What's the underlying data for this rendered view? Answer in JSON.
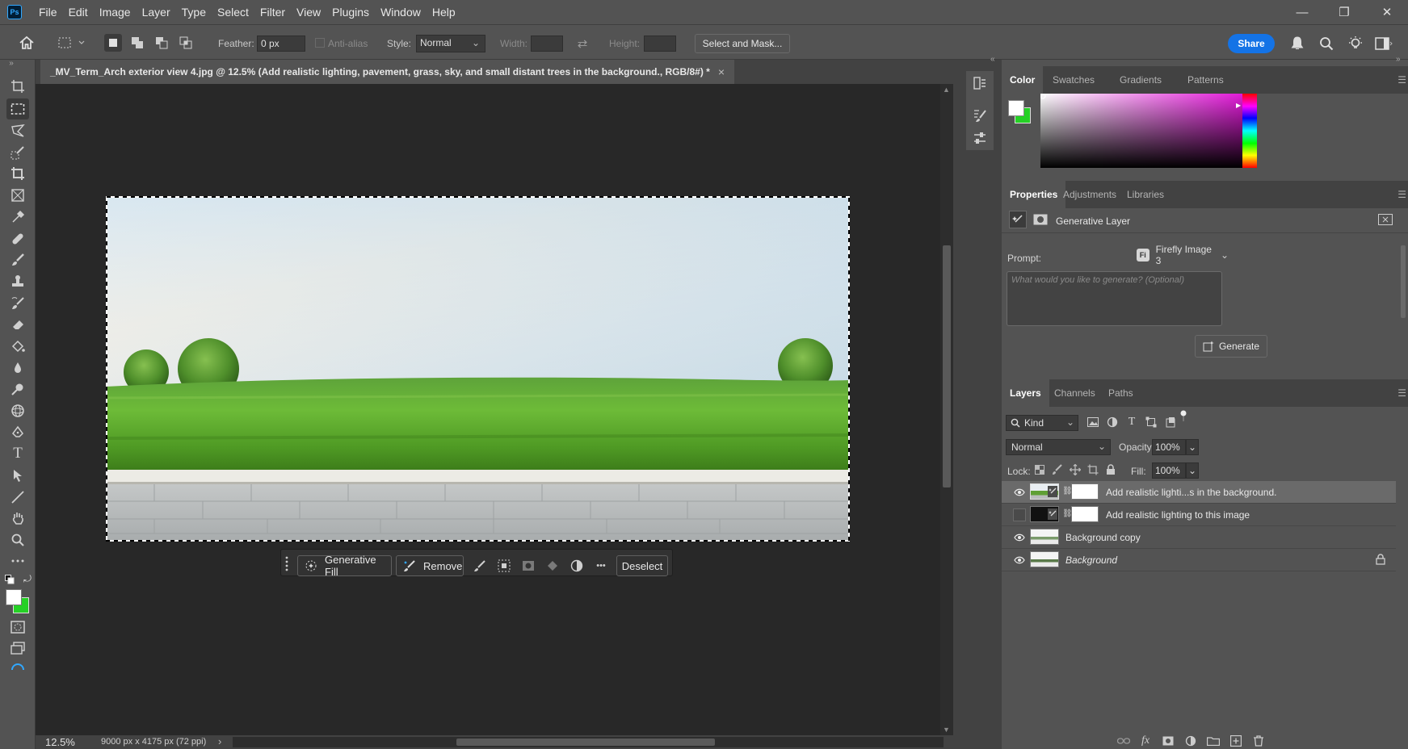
{
  "app": {
    "logo": "Ps"
  },
  "menu": [
    "File",
    "Edit",
    "Image",
    "Layer",
    "Type",
    "Select",
    "Filter",
    "View",
    "Plugins",
    "Window",
    "Help"
  ],
  "window_controls": {
    "minimize": "—",
    "restore": "❐",
    "close": "✕"
  },
  "options_bar": {
    "feather_label": "Feather:",
    "feather_value": "0 px",
    "antialias_label": "Anti-alias",
    "style_label": "Style:",
    "style_value": "Normal",
    "width_label": "Width:",
    "height_label": "Height:",
    "select_mask_label": "Select and Mask...",
    "share_label": "Share"
  },
  "document": {
    "tab_title": "_MV_Term_Arch exterior view 4.jpg @ 12.5% (Add realistic lighting, pavement, grass, sky, and small distant trees in the background., RGB/8#) *",
    "close": "×"
  },
  "contextual_taskbar": {
    "generative_fill_label": "Generative Fill",
    "remove_label": "Remove",
    "more_label": "•••",
    "deselect_label": "Deselect"
  },
  "status": {
    "zoom": "12.5%",
    "doc_size": "9000 px x 4175 px (72 ppi)",
    "arrow": "›"
  },
  "color_panel": {
    "tabs": [
      "Color",
      "Swatches",
      "Gradients",
      "Patterns"
    ],
    "active_tab": "Color",
    "foreground_color": "#ffffff",
    "background_color": "#25d125",
    "hue_color": "#e21ad8"
  },
  "properties_panel": {
    "tabs": [
      "Properties",
      "Adjustments",
      "Libraries"
    ],
    "active_tab": "Properties",
    "layer_type": "Generative Layer",
    "prompt_label": "Prompt:",
    "model_badge": "Fi",
    "model_label": "Firefly Image 3",
    "prompt_placeholder": "What would you like to generate? (Optional)",
    "generate_label": "Generate"
  },
  "layers_panel": {
    "tabs": [
      "Layers",
      "Channels",
      "Paths"
    ],
    "active_tab": "Layers",
    "filter_kind": "Kind",
    "blend_mode": "Normal",
    "opacity_label": "Opacity:",
    "opacity_value": "100%",
    "lock_label": "Lock:",
    "fill_label": "Fill:",
    "fill_value": "100%",
    "layers": [
      {
        "name": "Add realistic lighti...s in the background.",
        "visible": true,
        "selected": true
      },
      {
        "name": "Add realistic lighting to this image",
        "visible": false,
        "selected": false
      },
      {
        "name": "Background copy",
        "visible": true,
        "selected": false
      },
      {
        "name": "Background",
        "visible": true,
        "selected": false,
        "locked": true
      }
    ],
    "footer_fx": "fx"
  },
  "colors": {
    "accent_blue": "#1473e6",
    "canvas_bg": "#282828",
    "panel_bg": "#535353",
    "selected_layer": "#6a6a6a"
  }
}
